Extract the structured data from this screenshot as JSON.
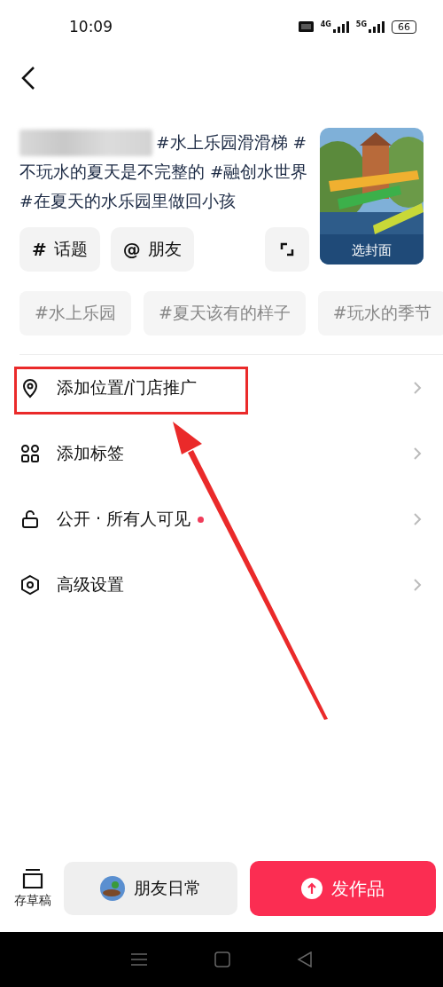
{
  "status_bar": {
    "time": "10:09",
    "network_labels": [
      "4G",
      "5G"
    ],
    "battery": "66"
  },
  "caption": {
    "text": "#水上乐园滑滑梯 #不玩水的夏天是不完整的 #融创水世界 #在夏天的水乐园里做回小孩",
    "redacted": true
  },
  "insert_buttons": [
    {
      "symbol": "#",
      "label": "话题"
    },
    {
      "symbol": "@",
      "label": "朋友"
    }
  ],
  "cover": {
    "kind": "picture",
    "label": "选封面"
  },
  "suggested_tags": [
    "#水上乐园",
    "#夏天该有的样子",
    "#玩水的季节"
  ],
  "menu": [
    {
      "label": "添加位置/门店推广",
      "dot": false,
      "highlighted": true
    },
    {
      "label": "添加标签",
      "dot": false,
      "highlighted": false
    },
    {
      "label": "公开 · 所有人可见",
      "dot": true,
      "highlighted": false
    },
    {
      "label": "高级设置",
      "dot": false,
      "highlighted": false
    }
  ],
  "bottom_bar": {
    "draft": "存草稿",
    "daily": "朋友日常",
    "publish": "发作品"
  }
}
